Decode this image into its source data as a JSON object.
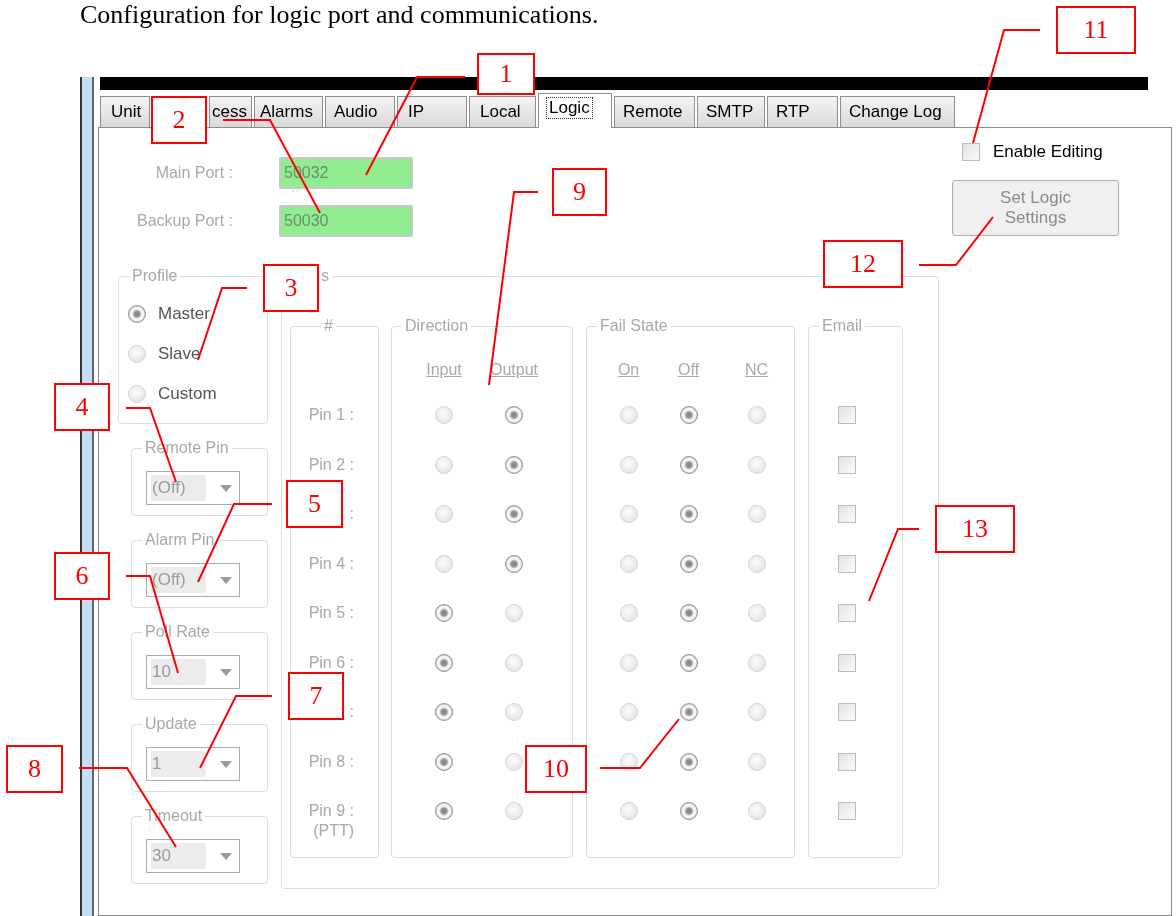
{
  "caption": "Configuration for logic port and communications.",
  "tabs": [
    {
      "label": "Unit",
      "selected": false
    },
    {
      "label": "cess",
      "selected": false
    },
    {
      "label": "Alarms",
      "selected": false
    },
    {
      "label": "Audio",
      "selected": false
    },
    {
      "label": "IP",
      "selected": false
    },
    {
      "label": "Local",
      "selected": false
    },
    {
      "label": "Logic",
      "selected": true
    },
    {
      "label": "Remote",
      "selected": false
    },
    {
      "label": "SMTP",
      "selected": false
    },
    {
      "label": "RTP",
      "selected": false
    },
    {
      "label": "Change Log",
      "selected": false
    }
  ],
  "ports": [
    {
      "label": "Main Port :",
      "value": "50032"
    },
    {
      "label": "Backup Port :",
      "value": "50030"
    }
  ],
  "enable_editing": {
    "label": "Enable Editing",
    "checked": false
  },
  "set_button": {
    "label": "Set Logic Settings"
  },
  "profile": {
    "legend": "Profile",
    "options": [
      {
        "label": "Master",
        "selected": true
      },
      {
        "label": "Slave",
        "selected": false
      },
      {
        "label": "Custom",
        "selected": false
      }
    ]
  },
  "combos": [
    {
      "legend": "Remote Pin",
      "value": "(Off)"
    },
    {
      "legend": "Alarm Pin",
      "value": "(Off)"
    },
    {
      "legend": "Poll Rate",
      "value": "10"
    },
    {
      "legend": "Update",
      "value": "1"
    },
    {
      "legend": "Timeout",
      "value": "30"
    }
  ],
  "pins_group": {
    "legend": "s",
    "number_legend": "#",
    "direction": {
      "legend": "Direction",
      "columns": [
        "Input",
        "Output"
      ]
    },
    "fail_state": {
      "legend": "Fail State",
      "columns": [
        "On",
        "Off",
        "NC"
      ]
    },
    "email": {
      "legend": "Email"
    }
  },
  "pins": [
    {
      "label": "Pin 1 :",
      "direction": [
        {
          "selected": false
        },
        {
          "selected": true
        }
      ],
      "fail_state": [
        {
          "selected": false
        },
        {
          "selected": true
        },
        {
          "selected": false
        }
      ],
      "email": {
        "checked": false
      }
    },
    {
      "label": "Pin 2 :",
      "direction": [
        {
          "selected": false
        },
        {
          "selected": true
        }
      ],
      "fail_state": [
        {
          "selected": false
        },
        {
          "selected": true
        },
        {
          "selected": false
        }
      ],
      "email": {
        "checked": false
      }
    },
    {
      "label": ":",
      "direction": [
        {
          "selected": false
        },
        {
          "selected": true
        }
      ],
      "fail_state": [
        {
          "selected": false
        },
        {
          "selected": true
        },
        {
          "selected": false
        }
      ],
      "email": {
        "checked": false
      }
    },
    {
      "label": "Pin 4 :",
      "direction": [
        {
          "selected": false
        },
        {
          "selected": true
        }
      ],
      "fail_state": [
        {
          "selected": false
        },
        {
          "selected": true
        },
        {
          "selected": false
        }
      ],
      "email": {
        "checked": false
      }
    },
    {
      "label": "Pin 5 :",
      "direction": [
        {
          "selected": true
        },
        {
          "selected": false
        }
      ],
      "fail_state": [
        {
          "selected": false
        },
        {
          "selected": true
        },
        {
          "selected": false
        }
      ],
      "email": {
        "checked": false
      }
    },
    {
      "label": "Pin 6 :",
      "direction": [
        {
          "selected": true
        },
        {
          "selected": false
        }
      ],
      "fail_state": [
        {
          "selected": false
        },
        {
          "selected": true
        },
        {
          "selected": false
        }
      ],
      "email": {
        "checked": false
      }
    },
    {
      "label": ":",
      "direction": [
        {
          "selected": true
        },
        {
          "selected": false
        }
      ],
      "fail_state": [
        {
          "selected": false
        },
        {
          "selected": true
        },
        {
          "selected": false
        }
      ],
      "email": {
        "checked": false
      }
    },
    {
      "label": "Pin 8 :",
      "direction": [
        {
          "selected": true
        },
        {
          "selected": false
        }
      ],
      "fail_state": [
        {
          "selected": false
        },
        {
          "selected": true
        },
        {
          "selected": false
        }
      ],
      "email": {
        "checked": false
      }
    },
    {
      "label": "Pin 9 :",
      "note": "(PTT)",
      "direction": [
        {
          "selected": true
        },
        {
          "selected": false
        }
      ],
      "fail_state": [
        {
          "selected": false
        },
        {
          "selected": true
        },
        {
          "selected": false
        }
      ],
      "email": {
        "checked": false
      }
    }
  ],
  "callouts": [
    {
      "label": "1"
    },
    {
      "label": "2"
    },
    {
      "label": "3"
    },
    {
      "label": "4"
    },
    {
      "label": "5"
    },
    {
      "label": "6"
    },
    {
      "label": "7"
    },
    {
      "label": "8"
    },
    {
      "label": "9"
    },
    {
      "label": "10"
    },
    {
      "label": "11"
    },
    {
      "label": "12"
    },
    {
      "label": "13"
    }
  ]
}
